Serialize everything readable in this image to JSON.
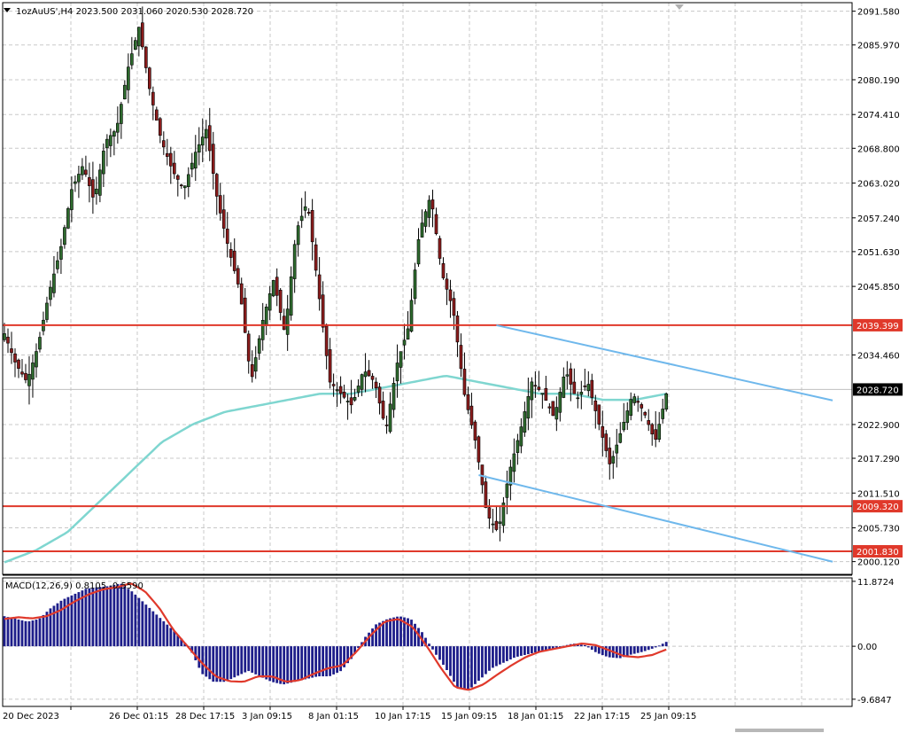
{
  "header": {
    "symbol_line": "1ozAuUS',H4  2023.500 2031.060 2020.530 2028.720",
    "macd_label": "MACD(12,26,9) 0.8105 -0.5590"
  },
  "colors": {
    "bull": "#2e6b2e",
    "bear": "#8b1c1c",
    "ma": "#7fd6d0",
    "hline": "#e0392b",
    "trend": "#6fb8ec",
    "hist": "#1e1e8a",
    "signal": "#e0392b",
    "grid": "#c8c8c8"
  },
  "chart_data": [
    {
      "type": "candlestick",
      "ylim": [
        1998,
        2093
      ],
      "price_ticks": [
        "2091.580",
        "2085.970",
        "2080.190",
        "2074.410",
        "2068.800",
        "2063.020",
        "2057.240",
        "2051.630",
        "2045.850",
        "2034.460",
        "2022.900",
        "2017.290",
        "2011.510",
        "2005.730",
        "2000.120"
      ],
      "x_labels": [
        "20 Dec 2023",
        "26 Dec 01:15",
        "28 Dec 17:15",
        "3 Jan 09:15",
        "8 Jan 01:15",
        "10 Jan 17:15",
        "15 Jan 09:15",
        "18 Jan 01:15",
        "22 Jan 17:15",
        "25 Jan 09:15"
      ],
      "last_price": "2028.720",
      "horizontal_levels": [
        {
          "value": 2039.399,
          "label": "2039.399"
        },
        {
          "value": 2009.32,
          "label": "2009.320"
        },
        {
          "value": 2001.83,
          "label": "2001.830"
        }
      ],
      "trendlines": [
        {
          "from": {
            "bar": 139,
            "price": 2039.4
          },
          "to": {
            "bar": 234,
            "price": 2026.9
          }
        },
        {
          "from": {
            "bar": 134,
            "price": 2014.5
          },
          "to": {
            "bar": 234,
            "price": 2000.1
          }
        }
      ],
      "key_closes": [
        2038,
        2033,
        2030,
        2036,
        2045,
        2052,
        2062,
        2066,
        2060,
        2070,
        2072,
        2082,
        2089,
        2078,
        2070,
        2065,
        2062,
        2068,
        2072,
        2060,
        2052,
        2045,
        2030,
        2040,
        2047,
        2038,
        2055,
        2060,
        2045,
        2030,
        2028,
        2026,
        2032,
        2030,
        2022,
        2033,
        2039,
        2055,
        2061,
        2048,
        2042,
        2028,
        2020,
        2008,
        2005,
        2015,
        2022,
        2030,
        2028,
        2024,
        2032,
        2027,
        2030,
        2023,
        2016,
        2022,
        2028,
        2025,
        2020,
        2028
      ],
      "moving_average": [
        2000,
        2002,
        2005,
        2010,
        2015,
        2020,
        2023,
        2025,
        2026,
        2027,
        2028,
        2028,
        2029,
        2030,
        2031,
        2030,
        2029,
        2028,
        2028,
        2027,
        2027,
        2028
      ]
    },
    {
      "type": "histogram",
      "title": "MACD(12,26,9) 0.8105 -0.5590",
      "ylim": [
        -11,
        12.5
      ],
      "ticks": [
        "11.8724",
        "0.00",
        "-9.6847"
      ],
      "histogram_keys": [
        5.5,
        5.0,
        4.5,
        5,
        7,
        8.5,
        9.5,
        10.5,
        10.8,
        11,
        11.5,
        10,
        8,
        6,
        4,
        2,
        -0.5,
        -5,
        -6.5,
        -6.5,
        -5.5,
        -4.5,
        -5.5,
        -6.5,
        -7,
        -6.5,
        -6,
        -5.5,
        -5.5,
        -4.5,
        -2,
        1.5,
        4,
        5,
        5.5,
        5,
        2.5,
        -1,
        -4,
        -7.5,
        -8,
        -6,
        -4,
        -3,
        -2,
        -1.5,
        -1,
        -0.5,
        0,
        0.5,
        0.2,
        -1.2,
        -2,
        -2.2,
        -1.5,
        -1.0,
        -0.3,
        0.8
      ],
      "signal_keys": [
        5,
        5.3,
        5.1,
        5.5,
        6.6,
        8.2,
        9.5,
        10.4,
        10.8,
        11.5,
        10,
        7,
        3,
        0,
        -3,
        -5.5,
        -6.4,
        -6.5,
        -5.5,
        -5.5,
        -6.5,
        -6.2,
        -5,
        -4,
        -3.5,
        -1,
        2,
        4.5,
        5,
        3.5,
        0,
        -4,
        -7.5,
        -8,
        -7,
        -5.2,
        -3.5,
        -2,
        -1,
        -0.5,
        0,
        0.5,
        0.2,
        -0.8,
        -1.8,
        -2,
        -1.6,
        -0.6
      ]
    }
  ]
}
